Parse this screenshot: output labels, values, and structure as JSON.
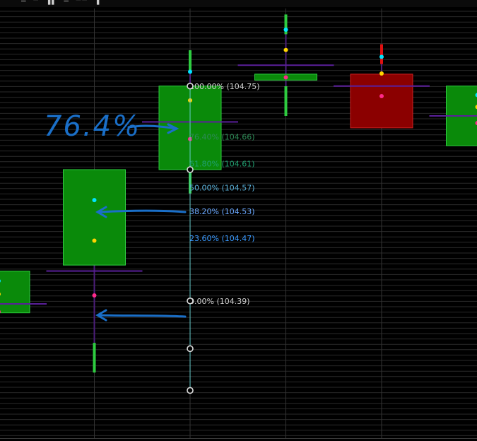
{
  "header": {
    "text": "— ▀ ▐▌ — ▀▀ ▐"
  },
  "chart_data": {
    "type": "candlestick",
    "title": "",
    "xlabel": "",
    "ylabel": "",
    "ylim": [
      104.16,
      104.88
    ],
    "grid": true,
    "colors": {
      "up": "#0a8a0a",
      "up_border": "#2ecc40",
      "down": "#8b0000",
      "down_border": "#cc2020",
      "grid": "#2a2a2a",
      "fib_line": "#66cccc",
      "annotation": "#1a6fc8"
    },
    "candles": [
      {
        "index": 0,
        "open": 104.37,
        "close": 104.44,
        "high": 104.44,
        "low": 104.33,
        "direction": "up"
      },
      {
        "index": 1,
        "open": 104.45,
        "close": 104.61,
        "high": 104.61,
        "low": 104.27,
        "direction": "up"
      },
      {
        "index": 2,
        "open": 104.61,
        "close": 104.75,
        "high": 104.81,
        "low": 104.57,
        "direction": "up"
      },
      {
        "index": 3,
        "open": 104.76,
        "close": 104.77,
        "high": 104.87,
        "low": 104.7,
        "direction": "up"
      },
      {
        "index": 4,
        "open": 104.77,
        "close": 104.68,
        "high": 104.82,
        "low": 104.68,
        "direction": "down"
      },
      {
        "index": 5,
        "open": 104.65,
        "close": 104.75,
        "high": 104.75,
        "low": 104.65,
        "direction": "up"
      }
    ],
    "fib_levels": [
      {
        "label": "100.00% (104.75)",
        "price": 104.75,
        "color": "#cfcfcf"
      },
      {
        "label": "76.40% (104.66)",
        "price": 104.665,
        "color": "#2e8b57"
      },
      {
        "label": "61.80% (104.61)",
        "price": 104.62,
        "color": "#20a070"
      },
      {
        "label": "50.00% (104.57)",
        "price": 104.58,
        "color": "#5ab0d8"
      },
      {
        "label": "38.20% (104.53)",
        "price": 104.54,
        "color": "#6aa8ff"
      },
      {
        "label": "23.60% (104.47)",
        "price": 104.495,
        "color": "#3a9aff"
      },
      {
        "label": "0.00% (104.39)",
        "price": 104.39,
        "color": "#cfcfcf"
      }
    ],
    "handles": [
      104.75,
      104.61,
      104.39,
      104.31,
      104.24
    ],
    "annotations": [
      {
        "text": "76.4%",
        "kind": "handwritten"
      }
    ]
  }
}
